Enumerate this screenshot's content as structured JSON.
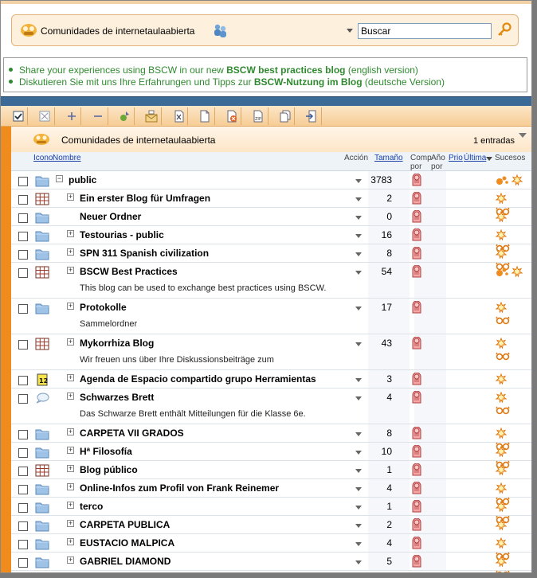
{
  "header": {
    "community_title": "Comunidades de internetaulaabierta",
    "search_value": "Buscar"
  },
  "news": {
    "line1_pre": "Share your experiences using BSCW in our new ",
    "line1_bold": "BSCW best practices blog",
    "line1_post": " (english version)",
    "line2_pre": "Diskutieren Sie mit uns Ihre Erfahrungen und Tipps zur ",
    "line2_bold": "BSCW-Nutzung im Blog",
    "line2_post": " (deutsche Version)"
  },
  "folder": {
    "title": "Comunidades de internetaulaabierta",
    "count": "1 entradas"
  },
  "columns": {
    "icono": "Icono",
    "nombre": "Nombre",
    "accion": "Acción",
    "tamano": "Tamaño",
    "comp_1": "Comp",
    "comp_2": "por",
    "ano_1": "Año",
    "ano_2": "por",
    "prio": "Prio",
    "ultima": "Última",
    "sucesos": "Sucesos"
  },
  "toolbar_icons": [
    "check-all-icon",
    "uncheck-icon",
    "add-icon",
    "remove-icon",
    "run-icon",
    "mail-icon",
    "cut-icon",
    "copy-icon",
    "delete-icon",
    "zip-icon",
    "duplicate-icon",
    "move-icon"
  ],
  "rows": [
    {
      "name": "public",
      "size": "3783",
      "icon": "folder",
      "tree": "minus",
      "indent": 0,
      "desc": "",
      "events": "sun-people"
    },
    {
      "name": "Ein erster Blog für Umfragen",
      "size": "2",
      "icon": "blog",
      "tree": "plus",
      "indent": 1,
      "desc": "",
      "events": "sun-glasses"
    },
    {
      "name": "Neuer Ordner",
      "size": "0",
      "icon": "folder",
      "tree": "none",
      "indent": 1,
      "desc": "",
      "events": "sun"
    },
    {
      "name": "Testourias - public",
      "size": "16",
      "icon": "folder",
      "tree": "plus",
      "indent": 1,
      "desc": "",
      "events": "sun-glasses"
    },
    {
      "name": "SPN 311 Spanish civilization",
      "size": "8",
      "icon": "folder",
      "tree": "plus",
      "indent": 1,
      "desc": "",
      "events": "sun-glasses"
    },
    {
      "name": "BSCW Best Practices",
      "size": "54",
      "icon": "blog",
      "tree": "plus",
      "indent": 1,
      "desc": "This blog can be used to exchange best practices using BSCW.",
      "events": "sun-people"
    },
    {
      "name": "Protokolle",
      "size": "17",
      "icon": "folder",
      "tree": "plus",
      "indent": 1,
      "desc": "Sammelordner",
      "events": "sun-glasses"
    },
    {
      "name": "Mykorrhiza Blog",
      "size": "43",
      "icon": "blog",
      "tree": "plus",
      "indent": 1,
      "desc": "Wir freuen uns über Ihre Diskussionsbeiträge zum",
      "events": "sun-glasses"
    },
    {
      "name": "Agenda de Espacio compartido grupo Herramientas",
      "size": "3",
      "icon": "calendar",
      "tree": "plus",
      "indent": 1,
      "desc": "",
      "events": "sun"
    },
    {
      "name": "Schwarzes Brett",
      "size": "4",
      "icon": "bubble",
      "tree": "plus",
      "indent": 1,
      "desc": "Das Schwarze Brett enthält Mitteilungen für die Klasse 6e.",
      "events": "sun-glasses"
    },
    {
      "name": "CARPETA VII GRADOS",
      "size": "8",
      "icon": "folder",
      "tree": "plus",
      "indent": 1,
      "desc": "",
      "events": "sun-glasses"
    },
    {
      "name": "Hª Filosofía",
      "size": "10",
      "icon": "folder",
      "tree": "plus",
      "indent": 1,
      "desc": "",
      "events": "sun-glasses"
    },
    {
      "name": "Blog público",
      "size": "1",
      "icon": "blog",
      "tree": "plus",
      "indent": 1,
      "desc": "",
      "events": "sun"
    },
    {
      "name": "Online-Infos zum Profil von Frank Reinemer",
      "size": "4",
      "icon": "folder",
      "tree": "plus",
      "indent": 1,
      "desc": "",
      "events": "sun-glasses"
    },
    {
      "name": "terco",
      "size": "1",
      "icon": "folder",
      "tree": "plus",
      "indent": 1,
      "desc": "",
      "events": "sun-glasses"
    },
    {
      "name": "CARPETA PUBLICA",
      "size": "2",
      "icon": "folder",
      "tree": "plus",
      "indent": 1,
      "desc": "",
      "events": "sun"
    },
    {
      "name": "EUSTACIO MALPICA",
      "size": "4",
      "icon": "folder",
      "tree": "plus",
      "indent": 1,
      "desc": "",
      "events": "sun-glasses"
    },
    {
      "name": "GABRIEL DIAMOND",
      "size": "5",
      "icon": "folder",
      "tree": "plus",
      "indent": 1,
      "desc": "",
      "events": "sun-glasses"
    }
  ],
  "colors": {
    "accent_orange": "#f08c1e",
    "news_green": "#2f8a2f",
    "bar_blue": "#3c6a97"
  }
}
